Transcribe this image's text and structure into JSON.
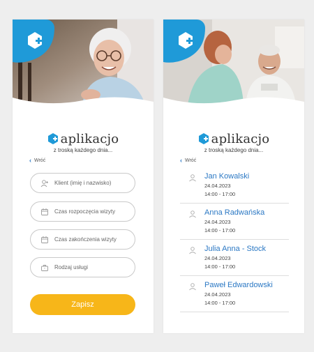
{
  "brand": {
    "name": "aplikacjo",
    "tagline": "z troską każdego dnia..."
  },
  "nav": {
    "back_label": "Wróć"
  },
  "form": {
    "fields": [
      {
        "placeholder": "Klient (imię i nazwisko)",
        "icon": "person-add-icon"
      },
      {
        "placeholder": "Czas rozpoczęcia wizyty",
        "icon": "calendar-icon"
      },
      {
        "placeholder": "Czas zakończenia wizyty",
        "icon": "calendar-icon"
      },
      {
        "placeholder": "Rodzaj usługi",
        "icon": "briefcase-icon"
      }
    ],
    "submit_label": "Zapisz"
  },
  "visits": [
    {
      "name": "Jan Kowalski",
      "date": "24.04.2023",
      "time": "14:00 - 17:00"
    },
    {
      "name": "Anna Radwańska",
      "date": "24.04.2023",
      "time": "14:00 - 17:00"
    },
    {
      "name": "Julia Anna - Stock",
      "date": "24.04.2023",
      "time": "14:00 - 17:00"
    },
    {
      "name": "Paweł Edwardowski",
      "date": "24.04.2023",
      "time": "14:00 - 17:00"
    }
  ],
  "colors": {
    "accent": "#2b78c4",
    "badge": "#1f9ad8",
    "button": "#f7b619",
    "background": "#eeeeee"
  }
}
